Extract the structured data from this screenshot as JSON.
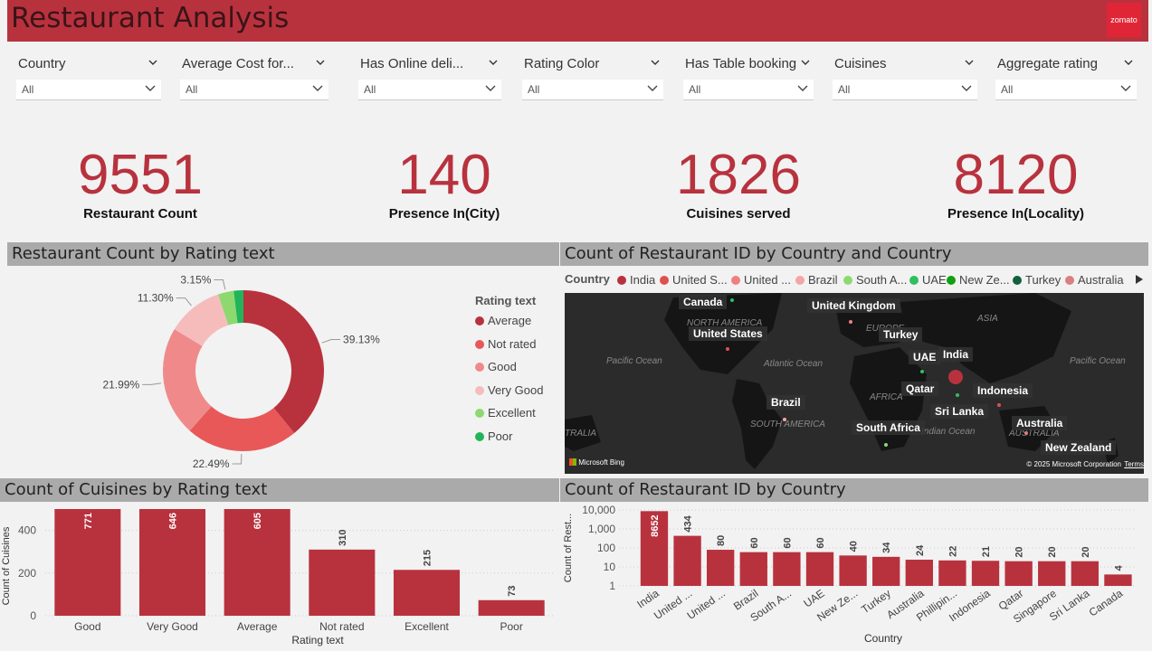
{
  "header": {
    "title": "Restaurant Analysis",
    "logo": "zomato"
  },
  "slicers": [
    {
      "label": "Country",
      "value": "All"
    },
    {
      "label": "Average Cost for...",
      "value": "All"
    },
    {
      "label": "Has Online deli...",
      "value": "All"
    },
    {
      "label": "Rating Color",
      "value": "All"
    },
    {
      "label": "Has Table booking",
      "value": "All"
    },
    {
      "label": "Cuisines",
      "value": "All"
    },
    {
      "label": "Aggregate rating",
      "value": "All"
    }
  ],
  "kpis": [
    {
      "value": "9551",
      "caption": "Restaurant Count"
    },
    {
      "value": "140",
      "caption": "Presence In(City)"
    },
    {
      "value": "1826",
      "caption": "Cuisines served"
    },
    {
      "value": "8120",
      "caption": "Presence In(Locality)"
    }
  ],
  "panels": {
    "donut_title": "Restaurant Count by Rating text",
    "map_title": "Count of Restaurant ID by Country and Country",
    "cuisine_title": "Count of Cuisines by Rating text",
    "country_title": "Count of Restaurant ID by Country"
  },
  "colors": {
    "accent": "#b8323e",
    "header": "#b8323e"
  },
  "donut_legend_title": "Rating text",
  "map": {
    "legend_title": "Country",
    "legend": [
      {
        "name": "India",
        "color": "#b8323e"
      },
      {
        "name": "United S...",
        "color": "#e05050"
      },
      {
        "name": "United ...",
        "color": "#f08080"
      },
      {
        "name": "Brazil",
        "color": "#f4a6a6"
      },
      {
        "name": "South A...",
        "color": "#8ed870"
      },
      {
        "name": "UAE",
        "color": "#2ec060"
      },
      {
        "name": "New Ze...",
        "color": "#10a010"
      },
      {
        "name": "Turkey",
        "color": "#106040"
      },
      {
        "name": "Australia",
        "color": "#d88080"
      }
    ],
    "labels": [
      "Canada",
      "United Kingdom",
      "United States",
      "Turkey",
      "UAE",
      "India",
      "Qatar",
      "Indonesia",
      "Brazil",
      "Sri Lanka",
      "South Africa",
      "Australia",
      "New Zealand"
    ],
    "geo": [
      "NORTH AMERICA",
      "EUROPE",
      "ASIA",
      "Pacific Ocean",
      "Atlantic Ocean",
      "AFRICA",
      "Pacific Ocean",
      "SOUTH AMERICA",
      "Indian Ocean",
      "AUSTRALIA",
      "TRALIA"
    ],
    "bing": "Microsoft Bing",
    "copyright": "© 2025 Microsoft Corporation",
    "terms": "Terms"
  },
  "chart_data": [
    {
      "type": "pie",
      "title": "Restaurant Count by Rating text",
      "legend_title": "Rating text",
      "categories": [
        "Average",
        "Not rated",
        "Good",
        "Very Good",
        "Excellent",
        "Poor"
      ],
      "values": [
        39.13,
        22.49,
        21.99,
        11.3,
        3.15,
        1.94
      ],
      "labels": [
        "39.13%",
        "22.49%",
        "21.99%",
        "11.30%",
        "3.15%",
        ""
      ],
      "colors": [
        "#b8323e",
        "#e85858",
        "#f08a8a",
        "#f6bcbc",
        "#8ed870",
        "#22b45a"
      ]
    },
    {
      "type": "bar",
      "title": "Count of Cuisines by Rating text",
      "xlabel": "Rating text",
      "ylabel": "Count of Cuisines",
      "categories": [
        "Good",
        "Very Good",
        "Average",
        "Not rated",
        "Excellent",
        "Poor"
      ],
      "values": [
        771,
        646,
        605,
        310,
        215,
        73
      ],
      "yticks": [
        0,
        200,
        400
      ],
      "ylim": [
        0,
        500
      ],
      "color": "#b8323e"
    },
    {
      "type": "bar",
      "title": "Count of Restaurant ID by Country",
      "xlabel": "Country",
      "ylabel": "Count of Rest...",
      "yscale": "log",
      "categories": [
        "India",
        "United ...",
        "United ...",
        "Brazil",
        "South A...",
        "UAE",
        "New Ze...",
        "Turkey",
        "Australia",
        "Phillipin...",
        "Indonesia",
        "Qatar",
        "Singapore",
        "Sri Lanka",
        "Canada"
      ],
      "values": [
        8652,
        434,
        80,
        60,
        60,
        60,
        40,
        34,
        24,
        22,
        21,
        20,
        20,
        20,
        4
      ],
      "yticks": [
        "1",
        "10",
        "100",
        "1,000",
        "10,000"
      ],
      "color": "#b8323e"
    }
  ]
}
